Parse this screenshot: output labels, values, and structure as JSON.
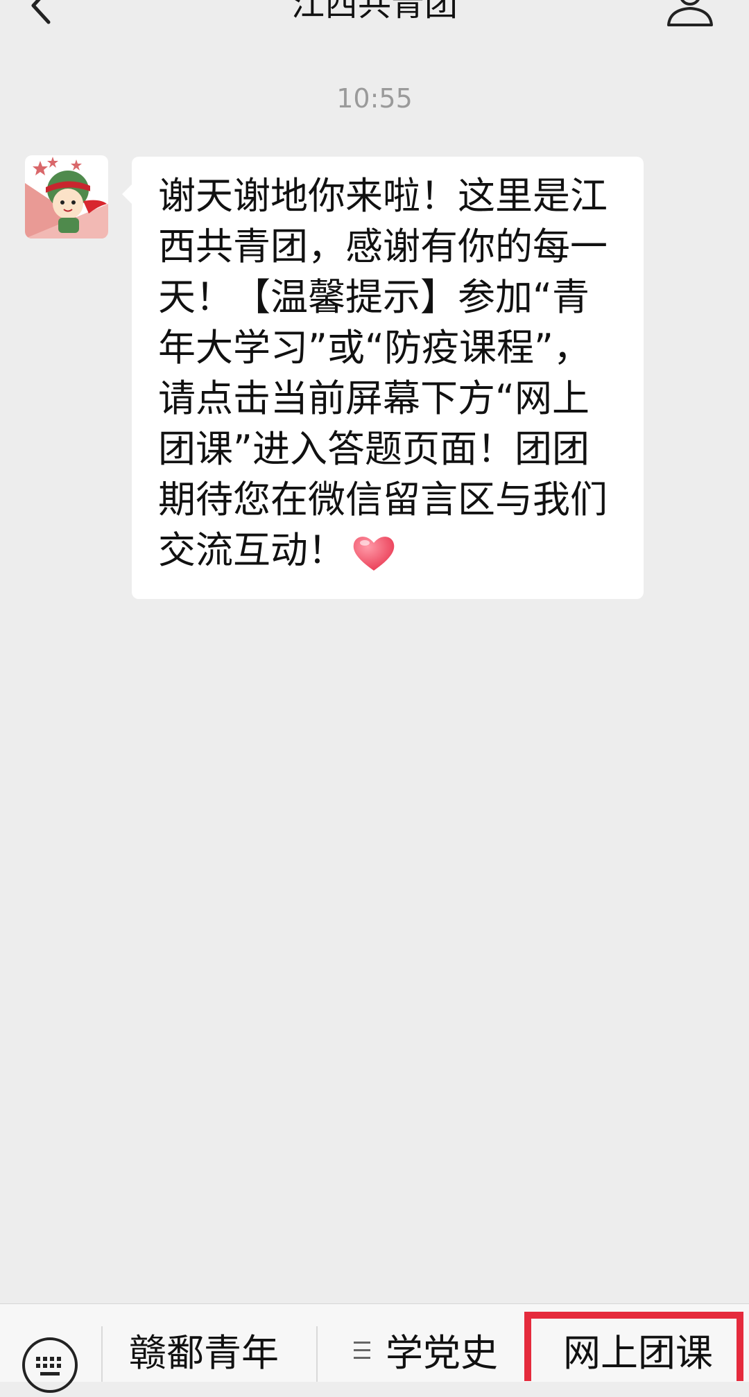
{
  "header": {
    "title": "江西共青团",
    "back_icon": "chevron-left-icon",
    "profile_icon": "person-icon"
  },
  "chat": {
    "timestamp": "10:55",
    "message": {
      "sender_avatar": "mascot-avatar",
      "text": "谢天谢地你来啦！这里是江西共青团，感谢有你的每一天！【温馨提示】参加“青年大学习”或“防疫课程”，请点击当前屏幕下方“网上团课”进入答题页面！团团期待您在微信留言区与我们交流互动！",
      "emoji": "heart-emoji"
    }
  },
  "menu": {
    "keyboard_icon": "keyboard-icon",
    "items": [
      {
        "label": "赣鄱青年"
      },
      {
        "label": "学党史",
        "icon": "list-icon"
      },
      {
        "label": "网上团课",
        "highlighted": true
      }
    ],
    "highlight_color": "#e52b3d"
  }
}
